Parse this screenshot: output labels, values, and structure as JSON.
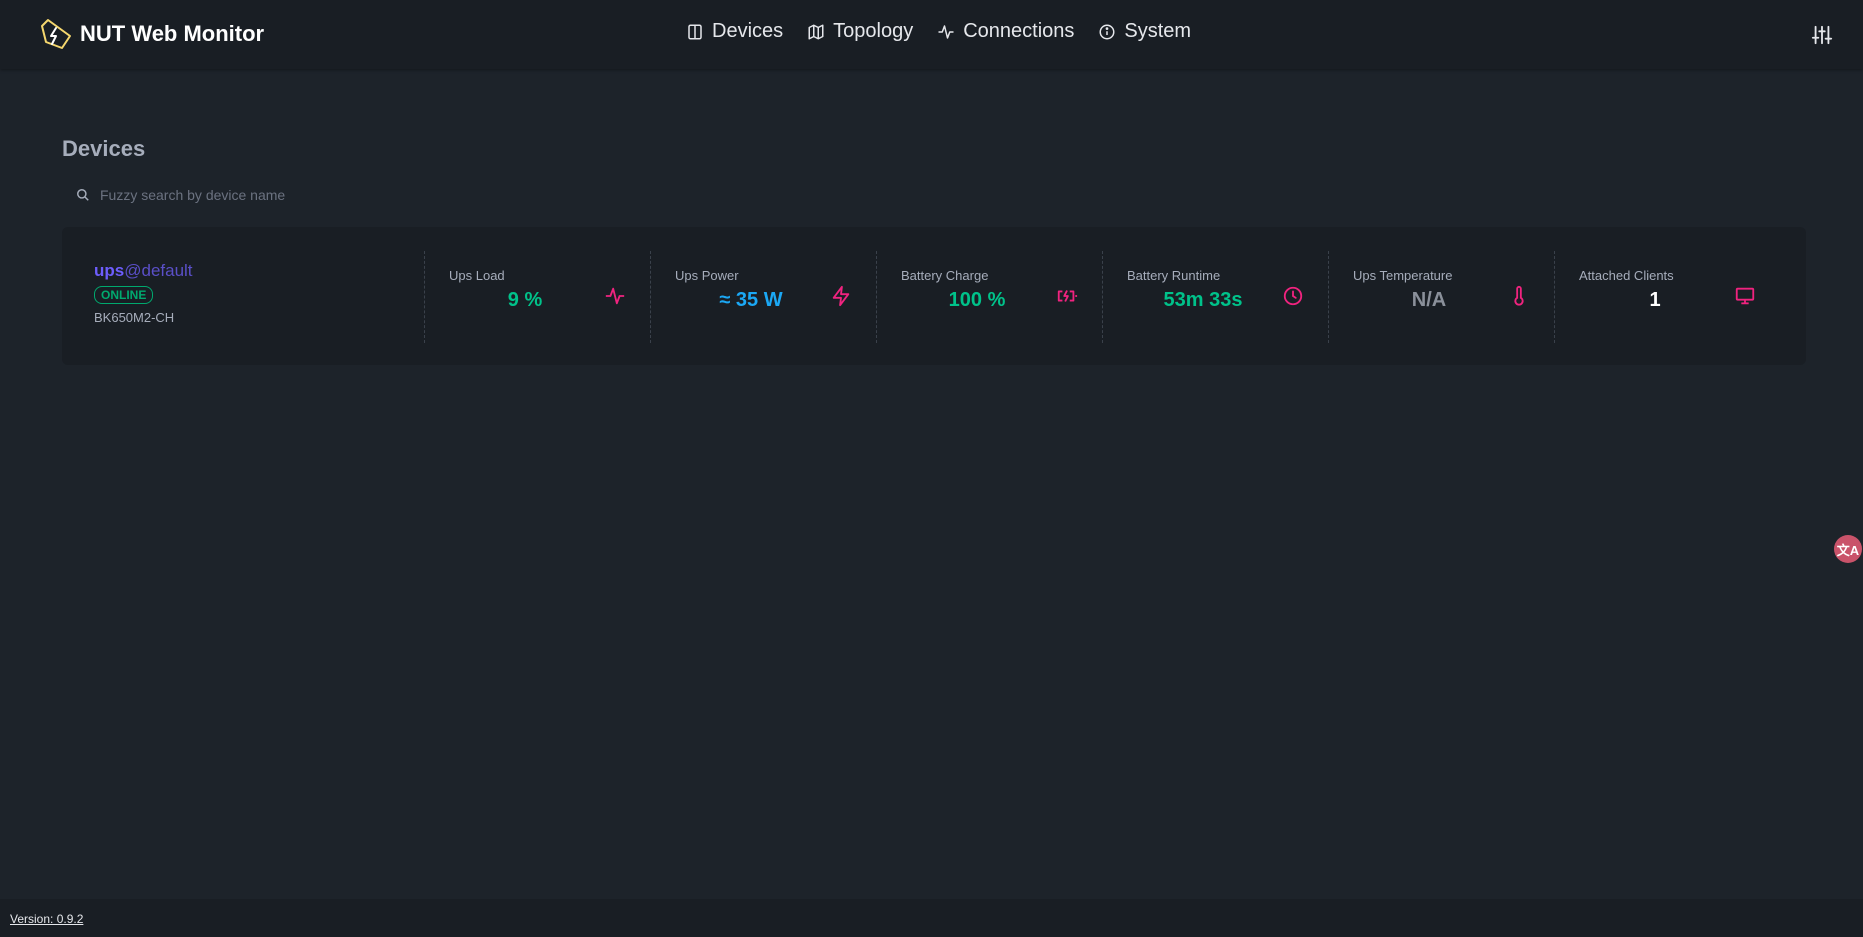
{
  "app": {
    "title": "NUT Web Monitor"
  },
  "nav": {
    "items": [
      {
        "label": "Devices",
        "icon": "book-icon"
      },
      {
        "label": "Topology",
        "icon": "map-icon"
      },
      {
        "label": "Connections",
        "icon": "activity-icon"
      },
      {
        "label": "System",
        "icon": "info-icon"
      }
    ]
  },
  "page": {
    "title": "Devices",
    "search_placeholder": "Fuzzy search by device name"
  },
  "device": {
    "name": "ups",
    "host": "@default",
    "status": "ONLINE",
    "model": "BK650M2-CH",
    "stats": [
      {
        "label": "Ups Load",
        "value": "9 %",
        "color": "#00c28a",
        "icon": "activity-icon"
      },
      {
        "label": "Ups Power",
        "value": "≈ 35 W",
        "color": "#1ba8f5",
        "icon": "lightning-icon"
      },
      {
        "label": "Battery Charge",
        "value": "100 %",
        "color": "#00c28a",
        "icon": "battery-charging-icon"
      },
      {
        "label": "Battery Runtime",
        "value": "53m 33s",
        "color": "#00c28a",
        "icon": "clock-icon"
      },
      {
        "label": "Ups Temperature",
        "value": "N/A",
        "color": "#8a909a",
        "icon": "thermometer-icon"
      },
      {
        "label": "Attached Clients",
        "value": "1",
        "color": "#ffffff",
        "icon": "monitor-icon"
      }
    ]
  },
  "colors": {
    "accent": "#f0237f",
    "brand": "#6d5dfc",
    "success": "#00a96e"
  },
  "footer": {
    "version": "Version: 0.9.2"
  }
}
